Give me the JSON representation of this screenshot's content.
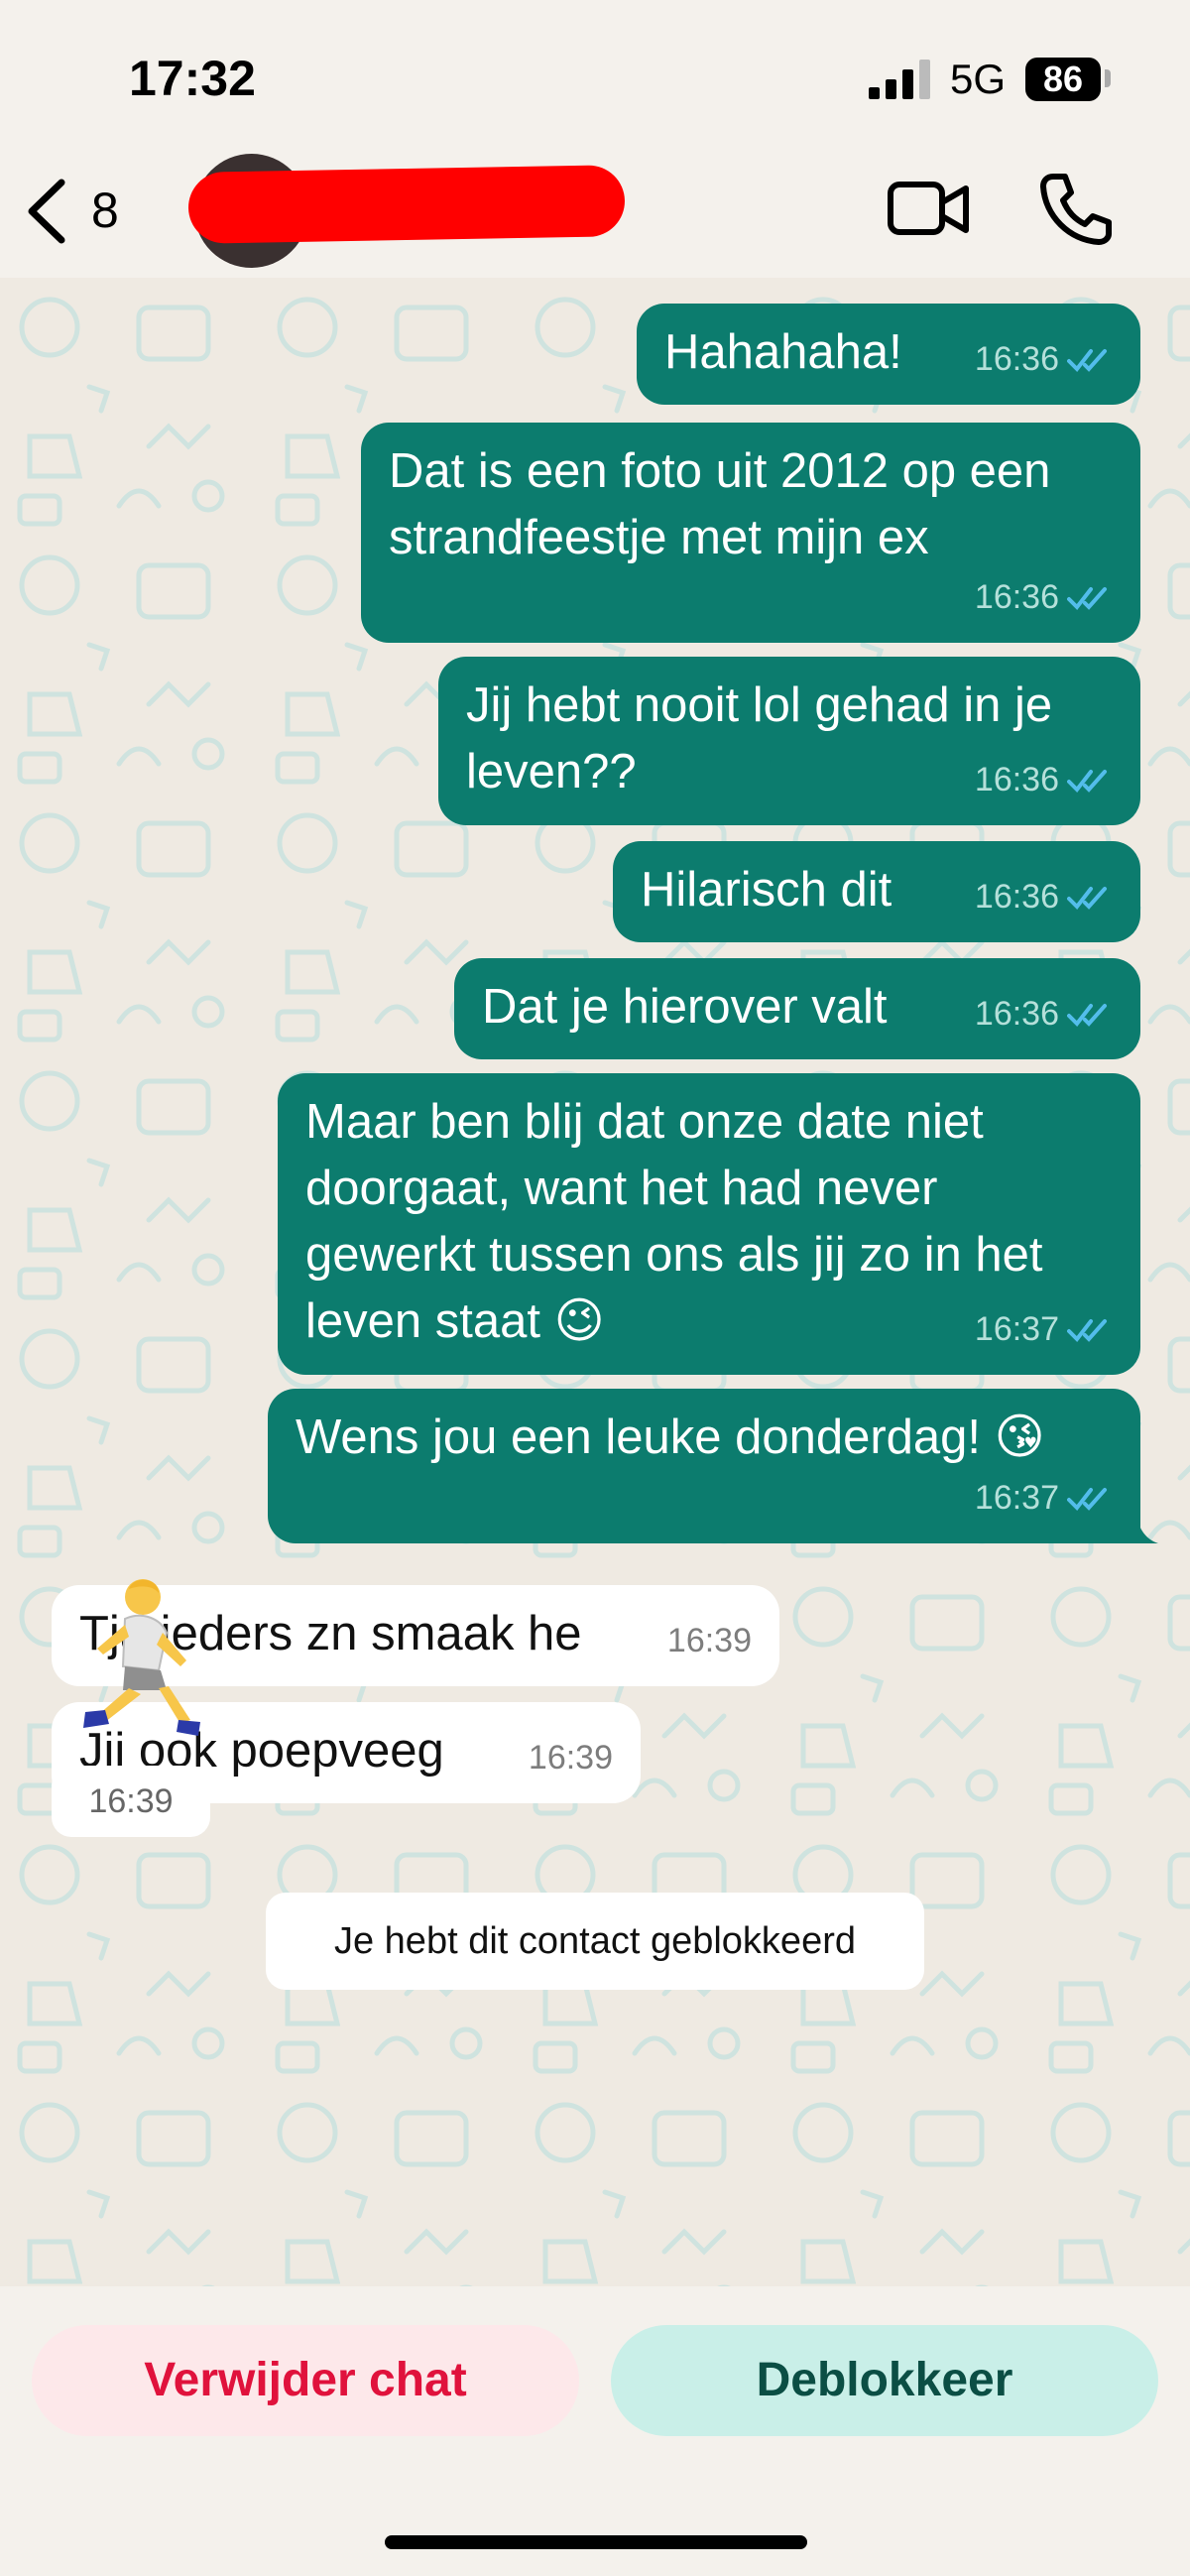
{
  "status_bar": {
    "time": "17:32",
    "network": "5G",
    "battery": "86"
  },
  "header": {
    "back_count": "8",
    "contact_name": ""
  },
  "messages": [
    {
      "text": "Hahahaha!",
      "time": "16:36"
    },
    {
      "text": "Dat is een foto uit 2012 op een\nstrandfeestje met mijn ex",
      "time": "16:36"
    },
    {
      "text": "Jij hebt nooit lol gehad in je\nleven??",
      "time": "16:36"
    },
    {
      "text": "Hilarisch dit",
      "time": "16:36"
    },
    {
      "text": "Dat je hierover valt",
      "time": "16:36"
    },
    {
      "text": "Maar ben blij dat onze date niet\ndoorgaat, want het had never\ngewerkt tussen ons als jij zo in het\nleven staat 😉",
      "time": "16:37"
    },
    {
      "text": "Wens jou een leuke donderdag! 😘",
      "time": "16:37"
    },
    {
      "text": "Tja ieders zn smaak he",
      "time": "16:39"
    },
    {
      "text": "Jij ook poepveeg",
      "time": "16:39"
    }
  ],
  "sticker": {
    "icon": "running-person-sticker",
    "time": "16:39"
  },
  "system_notice": "Je hebt dit contact geblokkeerd",
  "actions": {
    "delete_label": "Verwijder chat",
    "unblock_label": "Deblokkeer"
  },
  "colors": {
    "outgoing": "#0c7c6e",
    "incoming": "#ffffff",
    "read_ticks": "#53bdeb",
    "danger": "#e0123c",
    "accent": "#0b4e44"
  }
}
